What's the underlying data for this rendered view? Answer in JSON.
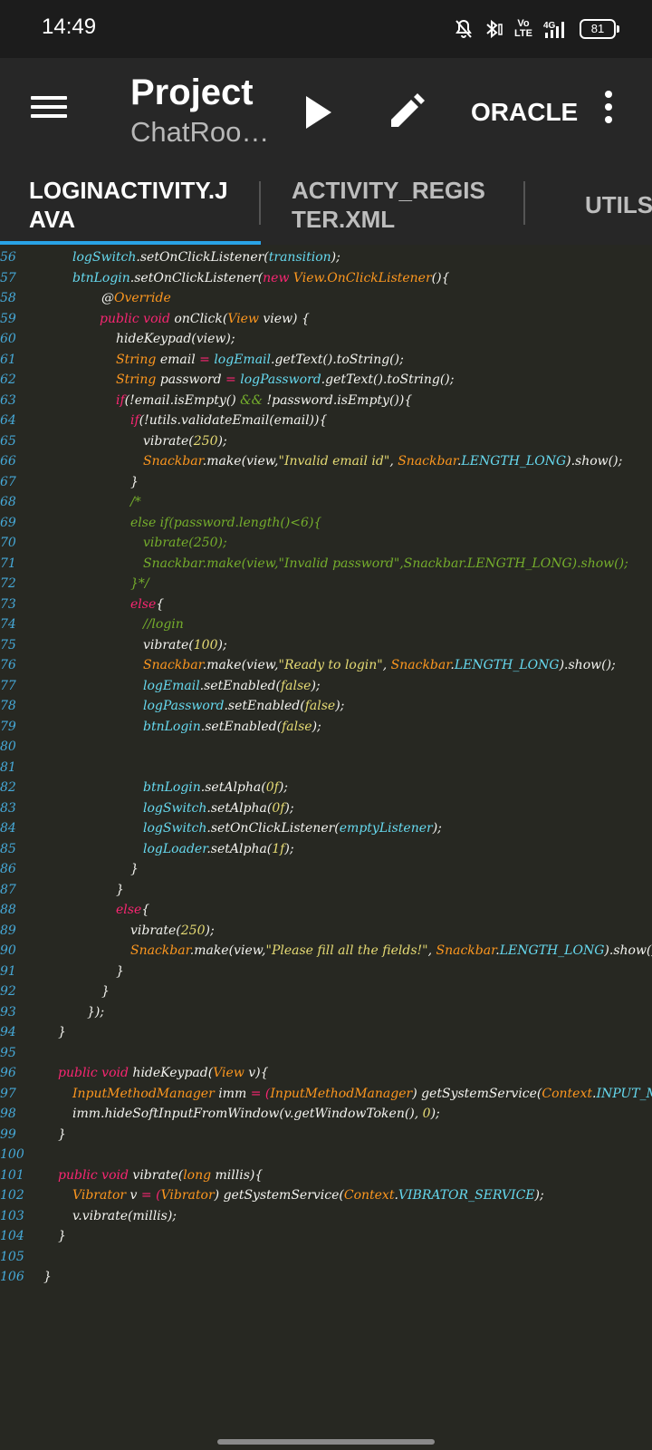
{
  "status_bar": {
    "time": "14:49",
    "battery": "81",
    "volte": "Vo\nLTE",
    "network": "4G"
  },
  "app_bar": {
    "title": "Project",
    "subtitle": "ChatRoo…",
    "oracle_label": "ORACLE",
    "icons": [
      "menu-icon",
      "play-icon",
      "pencil-icon",
      "more-vert-icon"
    ]
  },
  "tabs": [
    {
      "label": "LOGINACTIVITY.JAVA",
      "line1": "LOGINACTIVITY.J",
      "line2": "AVA",
      "active": true
    },
    {
      "label": "ACTIVITY_REGISTER.XML",
      "line1": "ACTIVITY_REGIS",
      "line2": "TER.XML",
      "active": false
    },
    {
      "label": "UTILS",
      "line1": "UTILS",
      "line2": "",
      "active": false
    }
  ],
  "colors": {
    "background": "#272822",
    "line_number": "#46a9d8",
    "keyword": "#f92672",
    "type": "#fd971f",
    "field": "#66d9ef",
    "string": "#e6db74",
    "comment": "#75ae2c",
    "plain": "#f4f4f0",
    "tab_indicator": "#29a3e6"
  },
  "code_lines": [
    {
      "n": "56",
      "indent": 80,
      "tokens": [
        [
          "logSwitch",
          "field"
        ],
        [
          ".setOnClickListener(",
          "plain"
        ],
        [
          "transition",
          "field"
        ],
        [
          ");",
          "plain"
        ]
      ]
    },
    {
      "n": "57",
      "indent": 80,
      "tokens": [
        [
          "btnLogin",
          "field"
        ],
        [
          ".setOnClickListener(",
          "plain"
        ],
        [
          "new ",
          "keyword"
        ],
        [
          "View.OnClickListener",
          "type"
        ],
        [
          "(){",
          "plain"
        ]
      ]
    },
    {
      "n": "58",
      "indent": 112,
      "tokens": [
        [
          "@",
          "plain"
        ],
        [
          "Override",
          "type"
        ]
      ]
    },
    {
      "n": "59",
      "indent": 110,
      "tokens": [
        [
          "public void ",
          "keyword"
        ],
        [
          "onClick(",
          "plain"
        ],
        [
          "View ",
          "type"
        ],
        [
          "view) {",
          "plain"
        ]
      ]
    },
    {
      "n": "60",
      "indent": 128,
      "tokens": [
        [
          "hideKeypad(view);",
          "plain"
        ]
      ]
    },
    {
      "n": "61",
      "indent": 128,
      "tokens": [
        [
          "String ",
          "type"
        ],
        [
          "email ",
          "plain"
        ],
        [
          "= ",
          "keyword"
        ],
        [
          "logEmail",
          "field"
        ],
        [
          ".getText().toString();",
          "plain"
        ]
      ]
    },
    {
      "n": "62",
      "indent": 128,
      "tokens": [
        [
          "String ",
          "type"
        ],
        [
          "password ",
          "plain"
        ],
        [
          "= ",
          "keyword"
        ],
        [
          "logPassword",
          "field"
        ],
        [
          ".getText().toString();",
          "plain"
        ]
      ]
    },
    {
      "n": "63",
      "indent": 128,
      "tokens": [
        [
          "if",
          "keyword"
        ],
        [
          "(!email.isEmpty() ",
          "plain"
        ],
        [
          "&& ",
          "comment"
        ],
        [
          "!password.isEmpty()){",
          "plain"
        ]
      ]
    },
    {
      "n": "64",
      "indent": 144,
      "tokens": [
        [
          "if",
          "keyword"
        ],
        [
          "(!utils.validateEmail(email)){",
          "plain"
        ]
      ]
    },
    {
      "n": "65",
      "indent": 158,
      "tokens": [
        [
          "vibrate(",
          "plain"
        ],
        [
          "250",
          "string"
        ],
        [
          ");",
          "plain"
        ]
      ]
    },
    {
      "n": "66",
      "indent": 158,
      "tokens": [
        [
          "Snackbar",
          "type"
        ],
        [
          ".make(view,",
          "plain"
        ],
        [
          "\"Invalid email id\"",
          "string"
        ],
        [
          ", ",
          "plain"
        ],
        [
          "Snackbar",
          "type"
        ],
        [
          ".",
          "plain"
        ],
        [
          "LENGTH_LONG",
          "field"
        ],
        [
          ").show();",
          "plain"
        ]
      ]
    },
    {
      "n": "67",
      "indent": 144,
      "tokens": [
        [
          "}",
          "plain"
        ]
      ]
    },
    {
      "n": "68",
      "indent": 144,
      "tokens": [
        [
          "/*",
          "comment"
        ]
      ]
    },
    {
      "n": "69",
      "indent": 144,
      "tokens": [
        [
          "else if(password.length()<6){",
          "comment"
        ]
      ]
    },
    {
      "n": "70",
      "indent": 158,
      "tokens": [
        [
          "vibrate(250);",
          "comment"
        ]
      ]
    },
    {
      "n": "71",
      "indent": 158,
      "tokens": [
        [
          "Snackbar.make(view,\"Invalid password\",Snackbar.LENGTH_LONG).show();",
          "comment"
        ]
      ]
    },
    {
      "n": "72",
      "indent": 144,
      "tokens": [
        [
          "}*/",
          "comment"
        ]
      ]
    },
    {
      "n": "73",
      "indent": 144,
      "tokens": [
        [
          "else",
          "keyword"
        ],
        [
          "{",
          "plain"
        ]
      ]
    },
    {
      "n": "74",
      "indent": 158,
      "tokens": [
        [
          "//login",
          "comment"
        ]
      ]
    },
    {
      "n": "75",
      "indent": 158,
      "tokens": [
        [
          "vibrate(",
          "plain"
        ],
        [
          "100",
          "string"
        ],
        [
          ");",
          "plain"
        ]
      ]
    },
    {
      "n": "76",
      "indent": 158,
      "tokens": [
        [
          "Snackbar",
          "type"
        ],
        [
          ".make(view,",
          "plain"
        ],
        [
          "\"Ready to login\"",
          "string"
        ],
        [
          ", ",
          "plain"
        ],
        [
          "Snackbar",
          "type"
        ],
        [
          ".",
          "plain"
        ],
        [
          "LENGTH_LONG",
          "field"
        ],
        [
          ").show();",
          "plain"
        ]
      ]
    },
    {
      "n": "77",
      "indent": 158,
      "tokens": [
        [
          "logEmail",
          "field"
        ],
        [
          ".setEnabled(",
          "plain"
        ],
        [
          "false",
          "string"
        ],
        [
          ");",
          "plain"
        ]
      ]
    },
    {
      "n": "78",
      "indent": 158,
      "tokens": [
        [
          "logPassword",
          "field"
        ],
        [
          ".setEnabled(",
          "plain"
        ],
        [
          "false",
          "string"
        ],
        [
          ");",
          "plain"
        ]
      ]
    },
    {
      "n": "79",
      "indent": 158,
      "tokens": [
        [
          "btnLogin",
          "field"
        ],
        [
          ".setEnabled(",
          "plain"
        ],
        [
          "false",
          "string"
        ],
        [
          ");",
          "plain"
        ]
      ]
    },
    {
      "n": "80",
      "indent": 0,
      "tokens": []
    },
    {
      "n": "81",
      "indent": 0,
      "tokens": []
    },
    {
      "n": "82",
      "indent": 158,
      "tokens": [
        [
          "btnLogin",
          "field"
        ],
        [
          ".setAlpha(",
          "plain"
        ],
        [
          "0f",
          "string"
        ],
        [
          ");",
          "plain"
        ]
      ]
    },
    {
      "n": "83",
      "indent": 158,
      "tokens": [
        [
          "logSwitch",
          "field"
        ],
        [
          ".setAlpha(",
          "plain"
        ],
        [
          "0f",
          "string"
        ],
        [
          ");",
          "plain"
        ]
      ]
    },
    {
      "n": "84",
      "indent": 158,
      "tokens": [
        [
          "logSwitch",
          "field"
        ],
        [
          ".setOnClickListener(",
          "plain"
        ],
        [
          "emptyListener",
          "field"
        ],
        [
          ");",
          "plain"
        ]
      ]
    },
    {
      "n": "85",
      "indent": 158,
      "tokens": [
        [
          "logLoader",
          "field"
        ],
        [
          ".setAlpha(",
          "plain"
        ],
        [
          "1f",
          "string"
        ],
        [
          ");",
          "plain"
        ]
      ]
    },
    {
      "n": "86",
      "indent": 144,
      "tokens": [
        [
          "}",
          "plain"
        ]
      ]
    },
    {
      "n": "87",
      "indent": 128,
      "tokens": [
        [
          "}",
          "plain"
        ]
      ]
    },
    {
      "n": "88",
      "indent": 128,
      "tokens": [
        [
          "else",
          "keyword"
        ],
        [
          "{",
          "plain"
        ]
      ]
    },
    {
      "n": "89",
      "indent": 144,
      "tokens": [
        [
          "vibrate(",
          "plain"
        ],
        [
          "250",
          "string"
        ],
        [
          ");",
          "plain"
        ]
      ]
    },
    {
      "n": "90",
      "indent": 144,
      "tokens": [
        [
          "Snackbar",
          "type"
        ],
        [
          ".make(view,",
          "plain"
        ],
        [
          "\"Please fill all the fields!\"",
          "string"
        ],
        [
          ", ",
          "plain"
        ],
        [
          "Snackbar",
          "type"
        ],
        [
          ".",
          "plain"
        ],
        [
          "LENGTH_LONG",
          "field"
        ],
        [
          ").show();",
          "plain"
        ]
      ]
    },
    {
      "n": "91",
      "indent": 128,
      "tokens": [
        [
          "}",
          "plain"
        ]
      ]
    },
    {
      "n": "92",
      "indent": 112,
      "tokens": [
        [
          "}",
          "plain"
        ]
      ]
    },
    {
      "n": "93",
      "indent": 96,
      "tokens": [
        [
          "});",
          "plain"
        ]
      ]
    },
    {
      "n": "94",
      "indent": 64,
      "tokens": [
        [
          "}",
          "plain"
        ]
      ]
    },
    {
      "n": "95",
      "indent": 0,
      "tokens": []
    },
    {
      "n": "96",
      "indent": 64,
      "tokens": [
        [
          "public void ",
          "keyword"
        ],
        [
          "hideKeypad(",
          "plain"
        ],
        [
          "View ",
          "type"
        ],
        [
          "v){",
          "plain"
        ]
      ]
    },
    {
      "n": "97",
      "indent": 80,
      "tokens": [
        [
          "InputMethodManager ",
          "type"
        ],
        [
          "imm ",
          "plain"
        ],
        [
          "= (",
          "keyword"
        ],
        [
          "InputMethodManager",
          "type"
        ],
        [
          ") getSystemService(",
          "plain"
        ],
        [
          "Context",
          "type"
        ],
        [
          ".",
          "plain"
        ],
        [
          "INPUT_METHOD_SERVICE",
          "field"
        ],
        [
          ");",
          "plain"
        ]
      ]
    },
    {
      "n": "98",
      "indent": 80,
      "tokens": [
        [
          "imm.hideSoftInputFromWindow(v.getWindowToken(), ",
          "plain"
        ],
        [
          "0",
          "string"
        ],
        [
          ");",
          "plain"
        ]
      ]
    },
    {
      "n": "99",
      "indent": 64,
      "tokens": [
        [
          "}",
          "plain"
        ]
      ]
    },
    {
      "n": "100",
      "indent": 0,
      "tokens": []
    },
    {
      "n": "101",
      "indent": 64,
      "tokens": [
        [
          "public void ",
          "keyword"
        ],
        [
          "vibrate(",
          "plain"
        ],
        [
          "long ",
          "type"
        ],
        [
          "millis){",
          "plain"
        ]
      ]
    },
    {
      "n": "102",
      "indent": 80,
      "tokens": [
        [
          "Vibrator ",
          "type"
        ],
        [
          "v ",
          "plain"
        ],
        [
          "= (",
          "keyword"
        ],
        [
          "Vibrator",
          "type"
        ],
        [
          ") getSystemService(",
          "plain"
        ],
        [
          "Context",
          "type"
        ],
        [
          ".",
          "plain"
        ],
        [
          "VIBRATOR_SERVICE",
          "field"
        ],
        [
          ");",
          "plain"
        ]
      ]
    },
    {
      "n": "103",
      "indent": 80,
      "tokens": [
        [
          "v.vibrate(millis);",
          "plain"
        ]
      ]
    },
    {
      "n": "104",
      "indent": 64,
      "tokens": [
        [
          "}",
          "plain"
        ]
      ]
    },
    {
      "n": "105",
      "indent": 0,
      "tokens": []
    },
    {
      "n": "106",
      "indent": 48,
      "tokens": [
        [
          "}",
          "plain"
        ]
      ]
    }
  ]
}
